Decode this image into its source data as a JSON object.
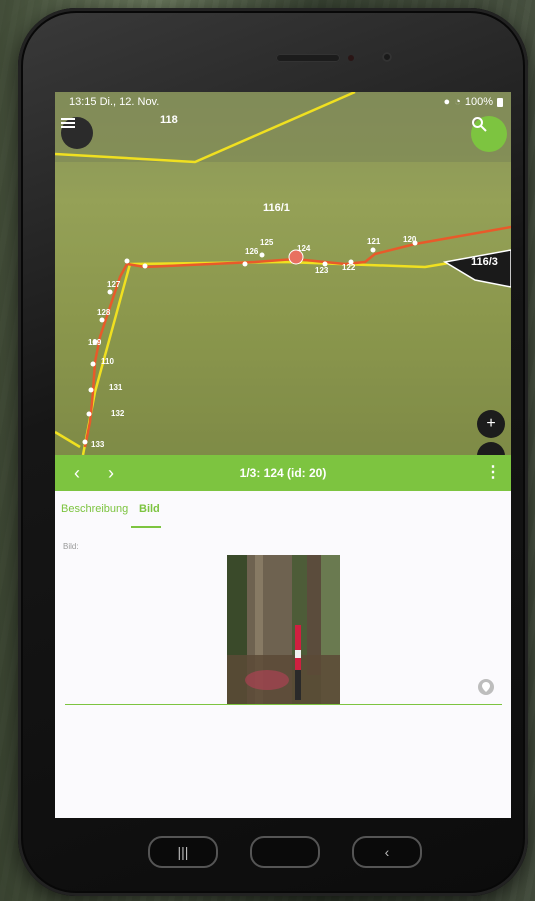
{
  "status": {
    "time": "13:15",
    "date": "Di., 12. Nov.",
    "battery": "100%"
  },
  "map": {
    "parcel_labels": [
      "118",
      "116/1",
      "116/3"
    ],
    "point_labels": [
      "125",
      "126",
      "124",
      "123",
      "122",
      "121",
      "120",
      "127",
      "128",
      "129",
      "110",
      "131",
      "132",
      "133"
    ]
  },
  "toolbar": {
    "prev": "‹",
    "next": "›",
    "title": "1/3: 124 (id: 20)",
    "more": "⋮"
  },
  "tabs": [
    {
      "label": "Beschreibung"
    },
    {
      "label": "Bild"
    }
  ],
  "content": {
    "field_label": "Bild:"
  },
  "colors": {
    "accent": "#7dc440",
    "parcel_line": "#f0e020",
    "track": "#e85a2a"
  },
  "icons": {
    "menu": "menu-icon",
    "search": "search-icon",
    "zoom_in": "plus-icon",
    "location": "location-pin-icon"
  }
}
